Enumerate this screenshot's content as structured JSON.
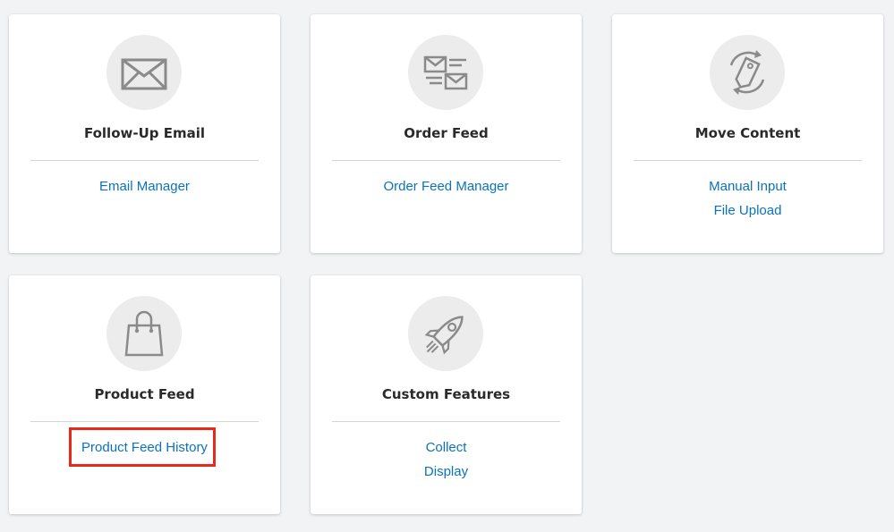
{
  "cards": [
    {
      "icon": "envelope-icon",
      "title": "Follow-Up Email",
      "links": [
        "Email Manager"
      ]
    },
    {
      "icon": "order-feed-icon",
      "title": "Order Feed",
      "links": [
        "Order Feed Manager"
      ]
    },
    {
      "icon": "move-tag-icon",
      "title": "Move Content",
      "links": [
        "Manual Input",
        "File Upload"
      ]
    },
    {
      "icon": "shopping-bag-icon",
      "title": "Product Feed",
      "links": [
        "Product Feed History"
      ],
      "highlighted_link": "Product Feed History"
    },
    {
      "icon": "rocket-icon",
      "title": "Custom Features",
      "links": [
        "Collect",
        "Display"
      ]
    }
  ],
  "colors": {
    "background": "#f1f3f4",
    "link": "#0a73bb",
    "highlight_border": "#e8291c",
    "icon_circle": "#ececec"
  }
}
